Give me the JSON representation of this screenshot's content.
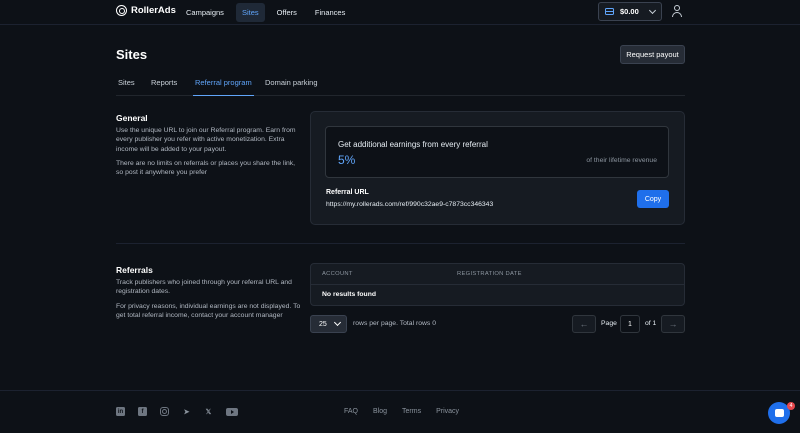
{
  "brand": {
    "name": "RollerAds"
  },
  "nav": {
    "items": [
      "Campaigns",
      "Sites",
      "Offers",
      "Finances"
    ],
    "active": "Sites"
  },
  "header": {
    "balance": "$0.00"
  },
  "page": {
    "title": "Sites",
    "payout_label": "Request payout"
  },
  "tabs": [
    "Sites",
    "Reports",
    "Referral program",
    "Domain parking"
  ],
  "active_tab": "Referral program",
  "general": {
    "title": "General",
    "text1": "Use the unique URL to join our Referral program. Earn from every publisher you refer with active monetization. Extra income will be added to your payout.",
    "text2": "There are no limits on referrals or places you share the link, so post it anywhere you prefer"
  },
  "earnings": {
    "title": "Get additional earnings from every referral",
    "percent": "5%",
    "subtitle": "of their lifetime revenue"
  },
  "referral": {
    "label": "Referral URL",
    "url": "https://my.rollerads.com/ref/990c32ae9-c7873cc346343",
    "copy_label": "Copy"
  },
  "referrals": {
    "title": "Referrals",
    "text1": "Track publishers who joined through your referral URL and registration dates.",
    "text2": "For privacy reasons, individual earnings are not displayed. To get total referral income, contact your account manager"
  },
  "table": {
    "columns": [
      "ACCOUNT",
      "REGISTRATION DATE"
    ],
    "empty": "No results found"
  },
  "pagination": {
    "rows_per_page": "25",
    "rows_text": "rows per page. Total rows 0",
    "page_label": "Page",
    "page_value": "1",
    "of_text": "of 1",
    "prev": "←",
    "next": "→"
  },
  "footer": {
    "social": [
      "linkedin-icon",
      "facebook-icon",
      "instagram-icon",
      "telegram-icon",
      "x-icon",
      "youtube-icon"
    ],
    "links": [
      "FAQ",
      "Blog",
      "Terms",
      "Privacy"
    ]
  },
  "chat": {
    "badge": "4"
  },
  "colors": {
    "accent": "#60a5fa",
    "button": "#1f6feb",
    "background": "#0d1117"
  }
}
